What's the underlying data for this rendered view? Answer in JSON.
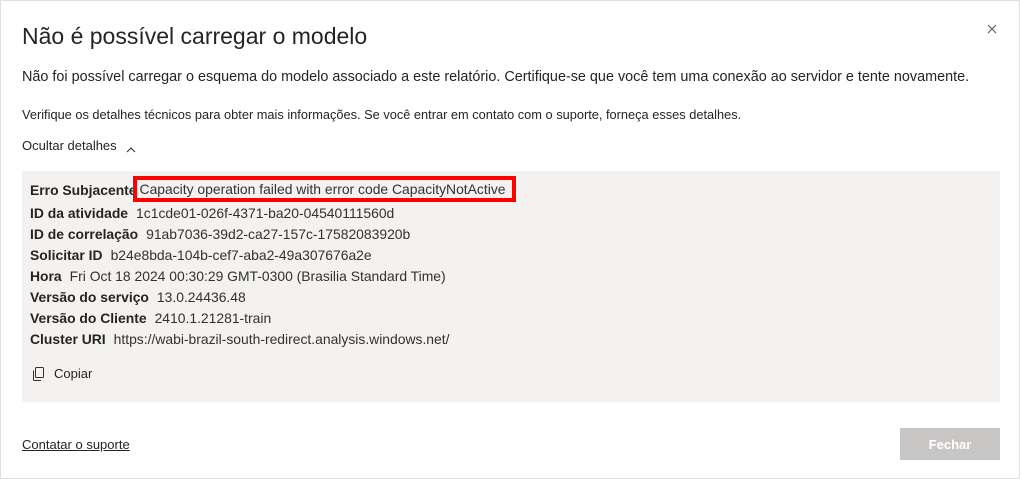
{
  "dialog": {
    "title": "Não é possível carregar o modelo",
    "message": "Não foi possível carregar o esquema do modelo associado a este relatório. Certifique-se que você tem uma conexão ao servidor e tente novamente.",
    "hint": "Verifique os detalhes técnicos para obter mais informações. Se você entrar em contato com o suporte, forneça esses detalhes.",
    "toggle_label": "Ocultar detalhes",
    "close_icon": "close-icon"
  },
  "details": {
    "rows": [
      {
        "label": "Erro Subjacente",
        "value": "Capacity operation failed with error code CapacityNotActive"
      },
      {
        "label": "ID da atividade",
        "value": "1c1cde01-026f-4371-ba20-04540111560d"
      },
      {
        "label": "ID de correlação",
        "value": "91ab7036-39d2-ca27-157c-17582083920b"
      },
      {
        "label": "Solicitar ID",
        "value": "b24e8bda-104b-cef7-aba2-49a307676a2e"
      },
      {
        "label": "Hora",
        "value": "Fri Oct 18 2024 00:30:29 GMT-0300 (Brasilia Standard Time)"
      },
      {
        "label": "Versão do serviço",
        "value": "13.0.24436.48"
      },
      {
        "label": "Versão do Cliente",
        "value": "2410.1.21281-train"
      },
      {
        "label": "Cluster URI",
        "value": "https://wabi-brazil-south-redirect.analysis.windows.net/"
      }
    ],
    "copy_label": "Copiar",
    "highlight_color": "#ff0000"
  },
  "footer": {
    "support_link": "Contatar o suporte",
    "close_button": "Fechar"
  }
}
